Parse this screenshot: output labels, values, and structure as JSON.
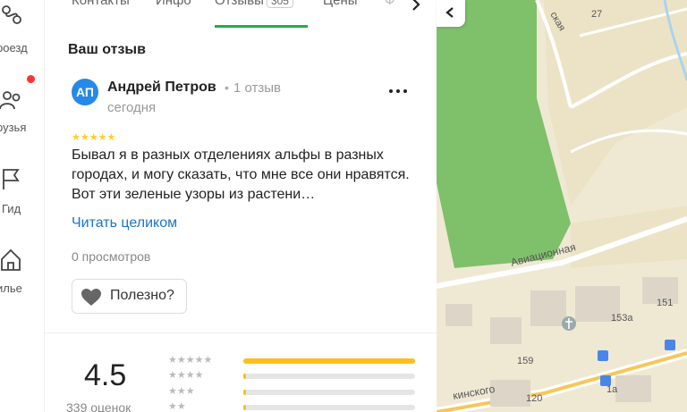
{
  "sidebar": {
    "items": [
      {
        "label": "роезд"
      },
      {
        "label": "рузья"
      },
      {
        "label": "Гид"
      },
      {
        "label": "илье"
      }
    ]
  },
  "tabs": [
    {
      "label": "Контакты"
    },
    {
      "label": "Инфо"
    },
    {
      "label": "Отзывы",
      "count": "305"
    },
    {
      "label": "Цены"
    },
    {
      "label": "Ф"
    }
  ],
  "review": {
    "section_title": "Ваш отзыв",
    "avatar_initials": "АП",
    "author": "Андрей Петров",
    "separator": "•",
    "author_reviews": "1 отзыв",
    "date": "сегодня",
    "stars": "★★★★★",
    "rating": 5,
    "text": "Бывал я в разных отделениях альфы в разных городах, и могу сказать, что мне все они нравятся. Вот эти зеленые узоры из растени…",
    "read_more": "Читать целиком",
    "views": "0 просмотров",
    "useful_label": "Полезно?"
  },
  "summary": {
    "rating_value": "4.5",
    "ratings_total": "339 оценок",
    "distribution": [
      {
        "stars": "★★★★★",
        "fraction": 1.0
      },
      {
        "stars": "★★★★",
        "fraction": 0.01
      },
      {
        "stars": "★★★",
        "fraction": 0.01
      },
      {
        "stars": "★★",
        "fraction": 0.01
      }
    ]
  },
  "map": {
    "labels": [
      "ская",
      "27",
      "Авиационная",
      "153а",
      "151",
      "159",
      "кинского",
      "120",
      "1а"
    ]
  },
  "colors": {
    "accent_green": "#1fb049",
    "link_blue": "#1a73c8",
    "star_yellow": "#fbbf1f",
    "avatar_blue": "#2689e8",
    "notification_red": "#ff3333"
  }
}
